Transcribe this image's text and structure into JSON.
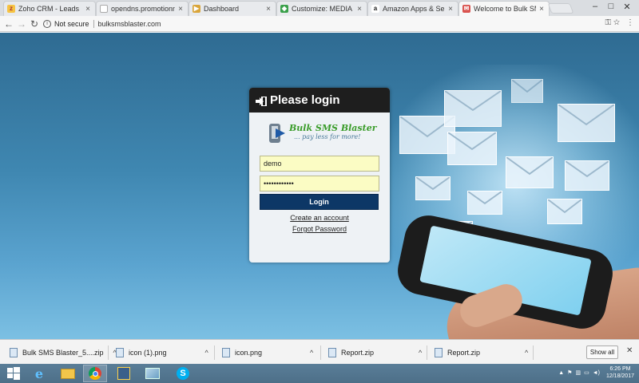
{
  "tabs": [
    {
      "label": "Zoho CRM - Leads",
      "icon": "zoho-icon",
      "active": false
    },
    {
      "label": "opendns.promotionmar",
      "icon": "page-icon",
      "active": false
    },
    {
      "label": "Dashboard",
      "icon": "dashboard-icon",
      "active": false
    },
    {
      "label": "Customize: MEDIA TOOL",
      "icon": "customize-icon",
      "active": false
    },
    {
      "label": "Amazon Apps & Services",
      "icon": "amazon-icon",
      "active": false
    },
    {
      "label": "Welcome to Bulk SMS Bl",
      "icon": "sms-icon",
      "active": true
    }
  ],
  "address": {
    "security_text": "Not secure",
    "url": "bulksmsblaster.com"
  },
  "login": {
    "title": "Please login",
    "brand": "Bulk SMS Blaster",
    "tagline": "... pay less for more!",
    "username_value": "demo",
    "password_value": "••••••••••••",
    "login_button": "Login",
    "create_account": "Create an account",
    "forgot_password": "Forgot Password"
  },
  "downloads": {
    "items": [
      {
        "name": "Bulk SMS Blaster_5....zip"
      },
      {
        "name": "icon (1).png"
      },
      {
        "name": "icon.png"
      },
      {
        "name": "Report.zip"
      },
      {
        "name": "Report.zip"
      }
    ],
    "show_all": "Show all"
  },
  "taskbar": {
    "time": "6:26 PM",
    "date": "12/18/2017"
  },
  "colors": {
    "login_header": "#1e1e1e",
    "login_button": "#0d3766",
    "input_bg": "#fbfcc4",
    "brand_green": "#3a9c2a"
  }
}
